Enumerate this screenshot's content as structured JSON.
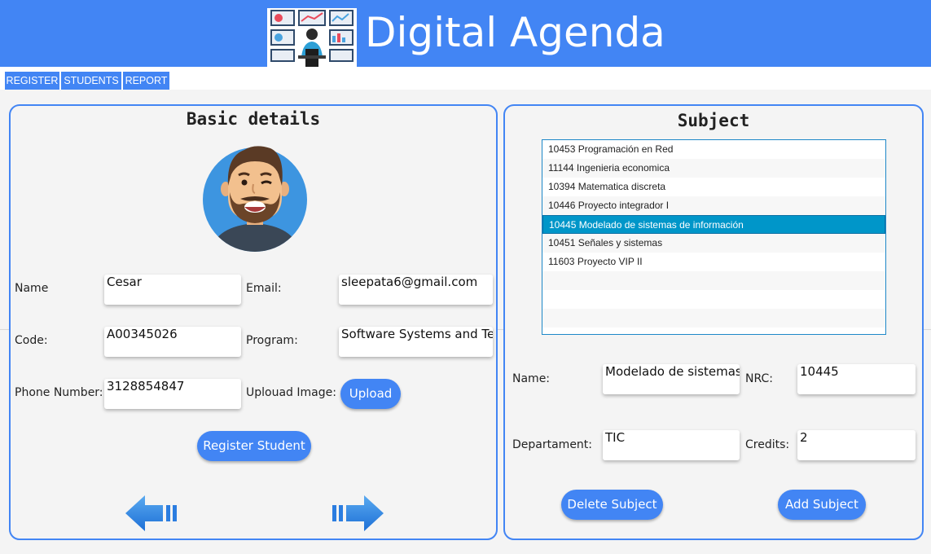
{
  "app": {
    "title": "Digital Agenda",
    "logo_icon": "monitoring-desk-icon"
  },
  "tabs": [
    {
      "label": "REGISTER"
    },
    {
      "label": "STUDENTS"
    },
    {
      "label": "REPORT"
    }
  ],
  "left_panel": {
    "title": "Basic details",
    "avatar_icon": "bearded-man-avatar",
    "fields": {
      "name_label": "Name",
      "name_value": "Cesar",
      "email_label": "Email:",
      "email_value": "sleepata6@gmail.com",
      "code_label": "Code:",
      "code_value": "A00345026",
      "program_label": "Program:",
      "program_value": "Software Systems and Telematics",
      "phone_label": "Phone Number:",
      "phone_value": "3128854847",
      "upload_label": "Uplouad Image:",
      "upload_button": "Upload"
    },
    "register_button": "Register Student",
    "prev_icon": "arrow-left-icon",
    "next_icon": "arrow-right-icon"
  },
  "right_panel": {
    "title": "Subject",
    "subjects": [
      {
        "label": "10453 Programación en Red"
      },
      {
        "label": "11144 Ingenieria economica"
      },
      {
        "label": "10394 Matematica discreta"
      },
      {
        "label": "10446 Proyecto integrador I"
      },
      {
        "label": "10445 Modelado de sistemas de información"
      },
      {
        "label": "10451 Señales y sistemas"
      },
      {
        "label": "11603 Proyecto VIP II"
      }
    ],
    "selected_index": 4,
    "fields": {
      "name_label": "Name:",
      "name_value": "Modelado de sistemas de información",
      "nrc_label": "NRC:",
      "nrc_value": "10445",
      "department_label": "Departament:",
      "department_value": "TIC",
      "credits_label": "Credits:",
      "credits_value": "2"
    },
    "delete_button": "Delete Subject",
    "add_button": "Add Subject"
  },
  "colors": {
    "accent": "#4285f4",
    "selection": "#0096c9",
    "background": "#f4f4f4"
  }
}
